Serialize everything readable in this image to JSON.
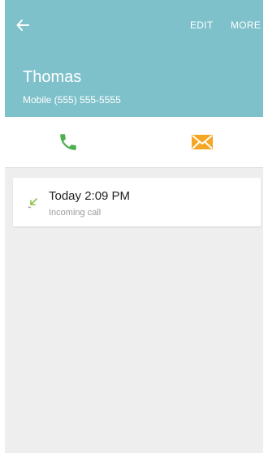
{
  "header": {
    "back_icon": "arrow-left-icon",
    "edit_label": "EDIT",
    "more_label": "MORE",
    "contact_name": "Thomas",
    "contact_number": "Mobile (555) 555-5555",
    "color": "#7ec1cb"
  },
  "actions": {
    "call_icon": "phone-icon",
    "call_color": "#4caf50",
    "message_icon": "envelope-icon",
    "message_color": "#f5a623"
  },
  "history": [
    {
      "time": "Today 2:09 PM",
      "type": "Incoming call",
      "icon": "incoming-call-icon"
    }
  ]
}
